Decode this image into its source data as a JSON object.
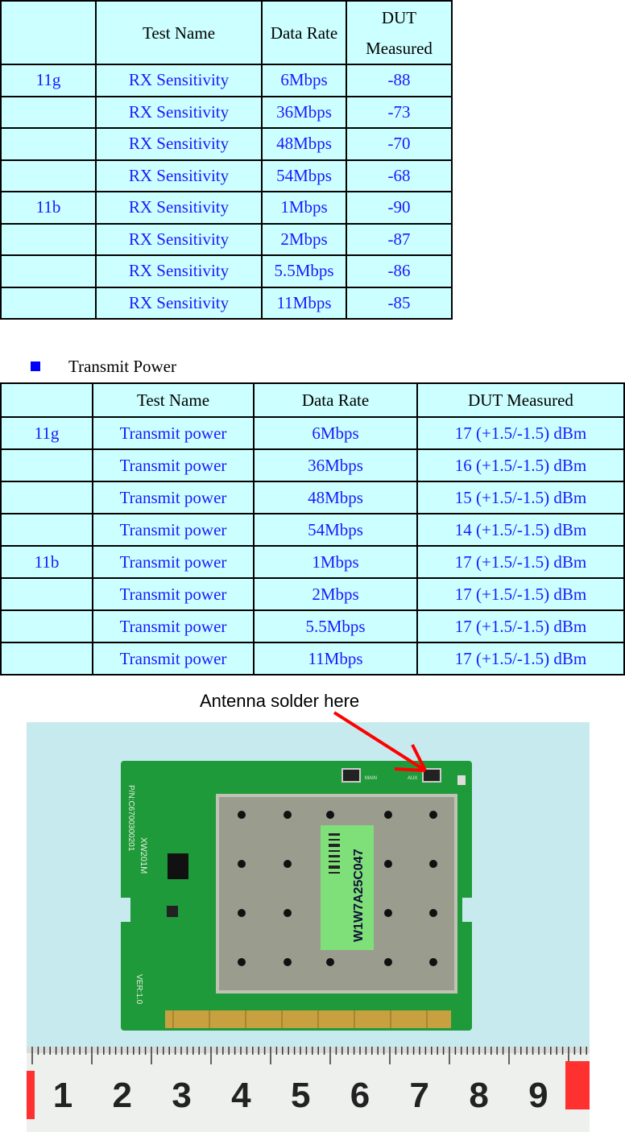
{
  "rx_table": {
    "headers": [
      "",
      "Test Name",
      "Data Rate",
      "DUT Measured"
    ],
    "header_dut_line1": "DUT",
    "header_dut_line2": "Measured",
    "rows": [
      {
        "mode": "11g",
        "test": "RX Sensitivity",
        "rate": "6Mbps",
        "value": "-88"
      },
      {
        "mode": "",
        "test": "RX Sensitivity",
        "rate": "36Mbps",
        "value": "-73"
      },
      {
        "mode": "",
        "test": "RX Sensitivity",
        "rate": "48Mbps",
        "value": "-70"
      },
      {
        "mode": "",
        "test": "RX Sensitivity",
        "rate": "54Mbps",
        "value": "-68"
      },
      {
        "mode": "11b",
        "test": "RX Sensitivity",
        "rate": "1Mbps",
        "value": "-90"
      },
      {
        "mode": "",
        "test": "RX Sensitivity",
        "rate": "2Mbps",
        "value": "-87"
      },
      {
        "mode": "",
        "test": "RX Sensitivity",
        "rate": "5.5Mbps",
        "value": "-86"
      },
      {
        "mode": "",
        "test": "RX Sensitivity",
        "rate": "11Mbps",
        "value": "-85"
      }
    ]
  },
  "section_title": "Transmit Power",
  "tx_table": {
    "headers": [
      "",
      "Test Name",
      "Data Rate",
      "DUT Measured"
    ],
    "rows": [
      {
        "mode": "11g",
        "test": "Transmit power",
        "rate": "6Mbps",
        "value": "17 (+1.5/-1.5) dBm"
      },
      {
        "mode": "",
        "test": "Transmit power",
        "rate": "36Mbps",
        "value": "16 (+1.5/-1.5) dBm"
      },
      {
        "mode": "",
        "test": "Transmit power",
        "rate": "48Mbps",
        "value": "15 (+1.5/-1.5) dBm"
      },
      {
        "mode": "",
        "test": "Transmit power",
        "rate": "54Mbps",
        "value": "14 (+1.5/-1.5) dBm"
      },
      {
        "mode": "11b",
        "test": "Transmit power",
        "rate": "1Mbps",
        "value": "17 (+1.5/-1.5) dBm"
      },
      {
        "mode": "",
        "test": "Transmit power",
        "rate": "2Mbps",
        "value": "17 (+1.5/-1.5) dBm"
      },
      {
        "mode": "",
        "test": "Transmit power",
        "rate": "5.5Mbps",
        "value": "17 (+1.5/-1.5) dBm"
      },
      {
        "mode": "",
        "test": "Transmit power",
        "rate": "11Mbps",
        "value": "17 (+1.5/-1.5) dBm"
      }
    ]
  },
  "photo": {
    "caption": "Antenna solder here",
    "board_label": "W1W7A25C047",
    "board_model": "XW201M",
    "board_pn": "P/N:C6700300201",
    "board_ver": "VER:1.0",
    "main_label": "MAIN",
    "aux_label": "AUX",
    "ruler_numbers": [
      "1",
      "2",
      "3",
      "4",
      "5",
      "6",
      "7",
      "8",
      "9"
    ]
  },
  "colors": {
    "table_bg": "#ccffff",
    "value_text": "#1a1aff",
    "bullet": "#0000ff",
    "arrow": "#ff0000"
  }
}
